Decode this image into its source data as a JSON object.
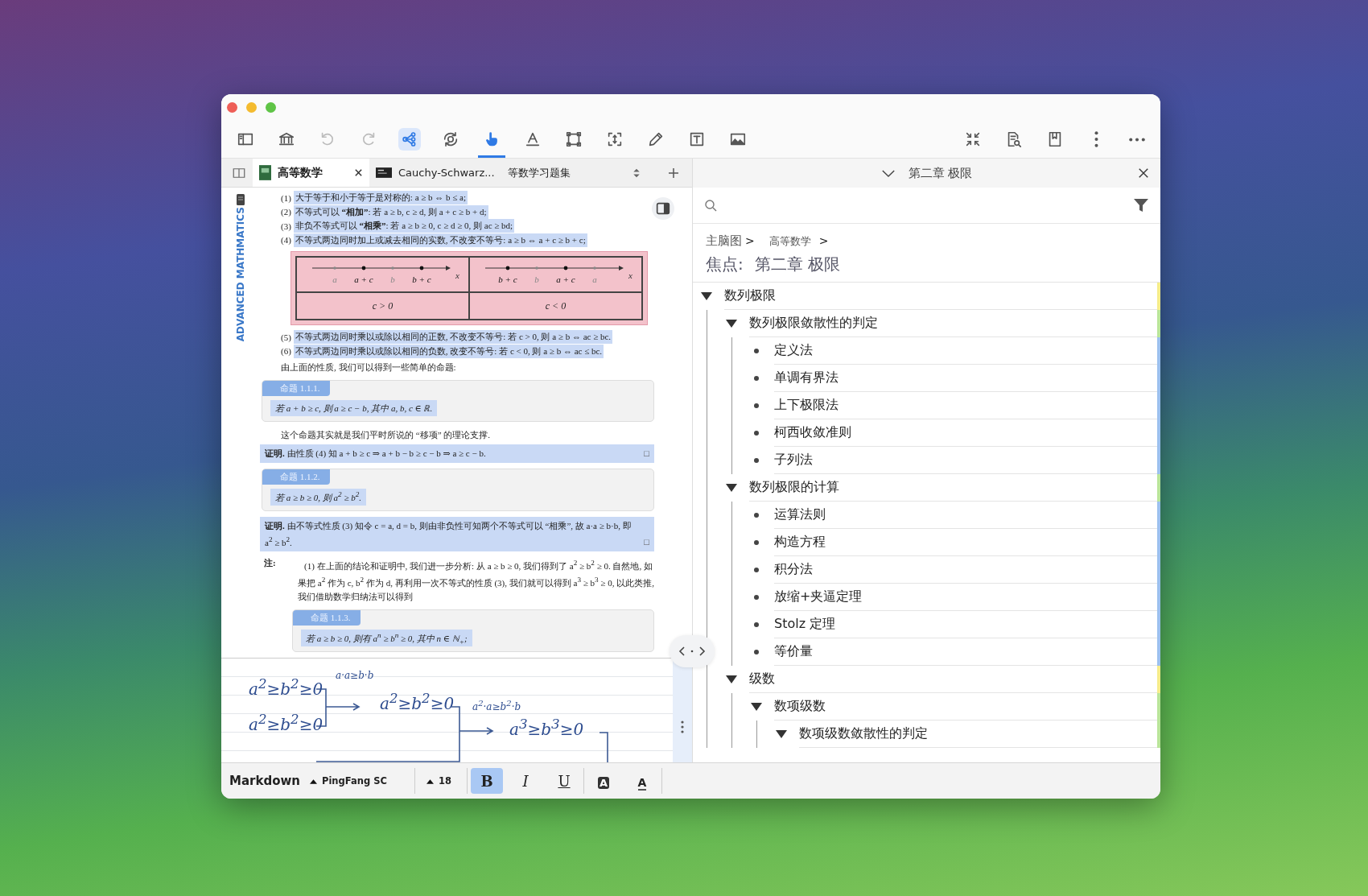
{
  "toolbar": {
    "left": [
      {
        "kind": "sidebar",
        "selected": false,
        "on": false,
        "disabled": false
      },
      {
        "kind": "library",
        "selected": false,
        "on": false,
        "disabled": false
      },
      {
        "kind": "undo",
        "selected": false,
        "on": false,
        "disabled": true
      },
      {
        "kind": "redo",
        "selected": false,
        "on": false,
        "disabled": true
      },
      {
        "kind": "mindmap",
        "selected": false,
        "on": true,
        "disabled": false
      },
      {
        "kind": "rotate",
        "selected": false,
        "on": false,
        "disabled": false
      },
      {
        "kind": "hand",
        "selected": true,
        "on": false,
        "disabled": false
      },
      {
        "kind": "text",
        "selected": false,
        "on": false,
        "disabled": false
      },
      {
        "kind": "select",
        "selected": false,
        "on": false,
        "disabled": false
      },
      {
        "kind": "frame",
        "selected": false,
        "on": false,
        "disabled": false
      },
      {
        "kind": "pen",
        "selected": false,
        "on": false,
        "disabled": false
      },
      {
        "kind": "textbox",
        "selected": false,
        "on": false,
        "disabled": false
      },
      {
        "kind": "image",
        "selected": false,
        "on": false,
        "disabled": false
      }
    ],
    "right": [
      {
        "kind": "collapse",
        "selected": false,
        "on": false,
        "disabled": false
      },
      {
        "kind": "docsearch",
        "selected": false,
        "on": false,
        "disabled": false
      },
      {
        "kind": "bookmark",
        "selected": false,
        "on": false,
        "disabled": false
      },
      {
        "kind": "kebab",
        "selected": false,
        "on": false,
        "disabled": false
      },
      {
        "kind": "dots",
        "selected": false,
        "on": false,
        "disabled": false
      }
    ]
  },
  "tabs": [
    {
      "kind": "book",
      "label": "高等数学",
      "selected": true
    },
    {
      "kind": "slide",
      "label": "Cauchy-Schwarz...",
      "selected": false
    },
    {
      "kind": "plain",
      "label": "等数学习题集",
      "selected": false
    }
  ],
  "document": {
    "margin_title": "ADVANCED MATHMATICS",
    "blocks": [
      {
        "kind": "property",
        "number": "(1)",
        "text": "大于等于和小于等于是对称的: a ≥ b ⇔ b ≤ a;"
      },
      {
        "kind": "property",
        "number": "(2)",
        "text": "不等式可以 **“相加”**: 若 a ≥ b, c ≥ d, 则 a + c ≥ b + d;"
      },
      {
        "kind": "property",
        "number": "(3)",
        "text": "非负不等式可以 **“相乘”**: 若 a ≥ b ≥ 0, c ≥ d ≥ 0, 则 ac ≥ bd;"
      },
      {
        "kind": "property",
        "number": "(4)",
        "text": "不等式两边同时加上或减去相同的实数, 不改变不等号: a ≥ b ⇔ a + c ≥ b + c;"
      },
      {
        "kind": "figure",
        "cells": [
          {
            "axis": "x",
            "caption": "c > 0",
            "points": [
              {
                "label": "a",
                "emphasis": false
              },
              {
                "label": "a + c",
                "emphasis": true
              },
              {
                "label": "b",
                "emphasis": false
              },
              {
                "label": "b + c",
                "emphasis": true
              }
            ]
          },
          {
            "axis": "x",
            "caption": "c < 0",
            "points": [
              {
                "label": "b + c",
                "emphasis": true
              },
              {
                "label": "b",
                "emphasis": false
              },
              {
                "label": "a + c",
                "emphasis": true
              },
              {
                "label": "a",
                "emphasis": false
              }
            ]
          }
        ]
      },
      {
        "kind": "property",
        "number": "(5)",
        "text": "不等式两边同时乘以或除以相同的正数, 不改变不等号: 若 c > 0, 则 a ≥ b ⇔ ac ≥ bc."
      },
      {
        "kind": "property",
        "number": "(6)",
        "text": "不等式两边同时乘以或除以相同的负数, 改变不等号: 若 c < 0, 则 a ≥ b ⇔ ac ≤ bc."
      },
      {
        "kind": "paragraph",
        "text": "由上面的性质, 我们可以得到一些简单的命题:"
      },
      {
        "kind": "theorem",
        "label": "命题 1.1.1.",
        "text": "若 a + b ≥ c, 则 a ≥ c − b, 其中 a, b, c ∈ ℝ."
      },
      {
        "kind": "paragraph",
        "text": "这个命题其实就是我们平时所说的 “移项” 的理论支撑."
      },
      {
        "kind": "proof",
        "text": "**证明.**  由性质 (4) 知 a + b ≥ c ⇒ a + b − b ≥ c − b ⇒ a ≥ c − b.",
        "end_mark": "□"
      },
      {
        "kind": "theorem",
        "label": "命题 1.1.2.",
        "text": "若 a ≥ b ≥ 0, 则 a$^{2}$ ≥ b$^{2}$."
      },
      {
        "kind": "proof",
        "text": "**证明.**  由不等式性质 (3) 知令 c = a, d = b, 则由非负性可知两个不等式可以 “相乘”, 故 a·a ≥ b·b, 即 a$^{2}$ ≥ b$^{2}$.",
        "end_mark": "□"
      },
      {
        "kind": "note",
        "label": "注:",
        "text": "(1) 在上面的结论和证明中, 我们进一步分析: 从 a ≥ b ≥ 0, 我们得到了 a$^{2}$ ≥ b$^{2}$ ≥ 0. 自然地, 如果把 a$^{2}$ 作为 c, b$^{2}$ 作为 d, 再利用一次不等式的性质 (3), 我们就可以得到 a$^{3}$ ≥ b$^{3}$ ≥ 0, 以此类推, 我们借助数学归纳法可以得到"
      },
      {
        "kind": "theorem",
        "label": "命题 1.1.3.",
        "text": "若 a ≥ b ≥ 0, 则有 a$^{n}$ ≥ b$^{n}$ ≥ 0, 其中 n ∈ ℕ$_{+}$;"
      }
    ]
  },
  "handwriting": [
    {
      "kind": "formula",
      "text": "a$^{2}$≥b$^{2}$≥0"
    },
    {
      "kind": "annotation",
      "text": "a·a≥b·b"
    },
    {
      "kind": "formula",
      "text": "a$^{2}$≥b$^{2}$≥0"
    },
    {
      "kind": "annotation",
      "text": "a$^{2}$·a≥b$^{2}$·b"
    },
    {
      "kind": "formula",
      "text": "a$^{2}$≥b$^{2}$≥0"
    },
    {
      "kind": "formula",
      "text": "a$^{3}$≥b$^{3}$≥0"
    }
  ],
  "outline": {
    "header": "第二章 极限",
    "breadcrumb": {
      "items": [
        "主脑图",
        "高等数学"
      ],
      "separator": ">"
    },
    "focus": {
      "label": "焦点:",
      "value": "第二章 极限"
    },
    "items": [
      {
        "label": "数列极限",
        "color": "#f5ec8a",
        "expanded": true,
        "children": [
          {
            "label": "数列极限敛散性的判定",
            "color": "#b9e59a",
            "expanded": true,
            "children": [
              {
                "label": "定义法",
                "color": "#9cc0ee"
              },
              {
                "label": "单调有界法",
                "color": "#9cc0ee"
              },
              {
                "label": "上下极限法",
                "color": "#9cc0ee"
              },
              {
                "label": "柯西收敛准则",
                "color": "#9cc0ee"
              },
              {
                "label": "子列法",
                "color": "#9cc0ee"
              }
            ]
          },
          {
            "label": "数列极限的计算",
            "color": "#b9e59a",
            "expanded": true,
            "children": [
              {
                "label": "运算法则",
                "color": "#9cc0ee"
              },
              {
                "label": "构造方程",
                "color": "#9cc0ee"
              },
              {
                "label": "积分法",
                "color": "#9cc0ee"
              },
              {
                "label": "放缩+夹逼定理",
                "color": "#9cc0ee"
              },
              {
                "label": "Stolz 定理",
                "color": "#9cc0ee"
              },
              {
                "label": "等价量",
                "color": "#9cc0ee"
              }
            ]
          },
          {
            "label": "级数",
            "color": "#f5ec8a",
            "expanded": true,
            "children": [
              {
                "label": "数项级数",
                "color": "#b9e59a",
                "expanded": true,
                "children": [
                  {
                    "label": "数项级数敛散性的判定",
                    "color": "#b9e59a",
                    "expanded": true
                  }
                ]
              }
            ]
          }
        ]
      }
    ]
  },
  "format_bar": {
    "mode": "Markdown",
    "font": "PingFang SC",
    "size": "18",
    "styles": [
      {
        "kind": "bold",
        "label": "B",
        "selected": true
      },
      {
        "kind": "italic",
        "label": "I",
        "selected": false
      },
      {
        "kind": "underline",
        "label": "U",
        "selected": false
      }
    ],
    "colors": [
      {
        "kind": "highlight",
        "label": "A"
      },
      {
        "kind": "text-color",
        "label": "A"
      }
    ]
  }
}
